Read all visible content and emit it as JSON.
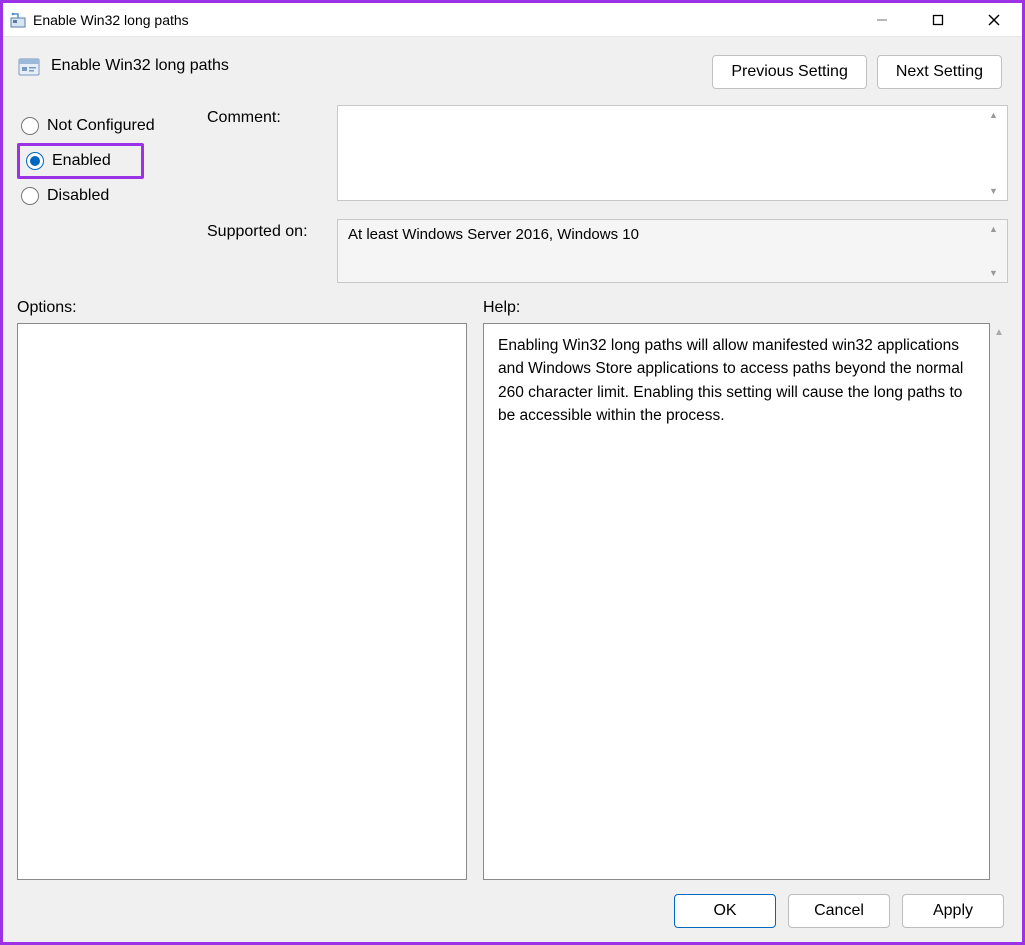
{
  "window": {
    "title": "Enable Win32 long paths"
  },
  "header": {
    "policy_title": "Enable Win32 long paths",
    "previous_btn": "Previous Setting",
    "next_btn": "Next Setting"
  },
  "radios": {
    "not_configured": "Not Configured",
    "enabled": "Enabled",
    "disabled": "Disabled",
    "selected": "enabled"
  },
  "labels": {
    "comment": "Comment:",
    "supported_on": "Supported on:",
    "options": "Options:",
    "help": "Help:"
  },
  "fields": {
    "comment_value": "",
    "supported_on_value": "At least Windows Server 2016, Windows 10"
  },
  "help_text": "Enabling Win32 long paths will allow manifested win32 applications and Windows Store applications to access paths beyond the normal 260 character limit.  Enabling this setting will cause the long paths to be accessible within the process.",
  "footer": {
    "ok": "OK",
    "cancel": "Cancel",
    "apply": "Apply"
  }
}
